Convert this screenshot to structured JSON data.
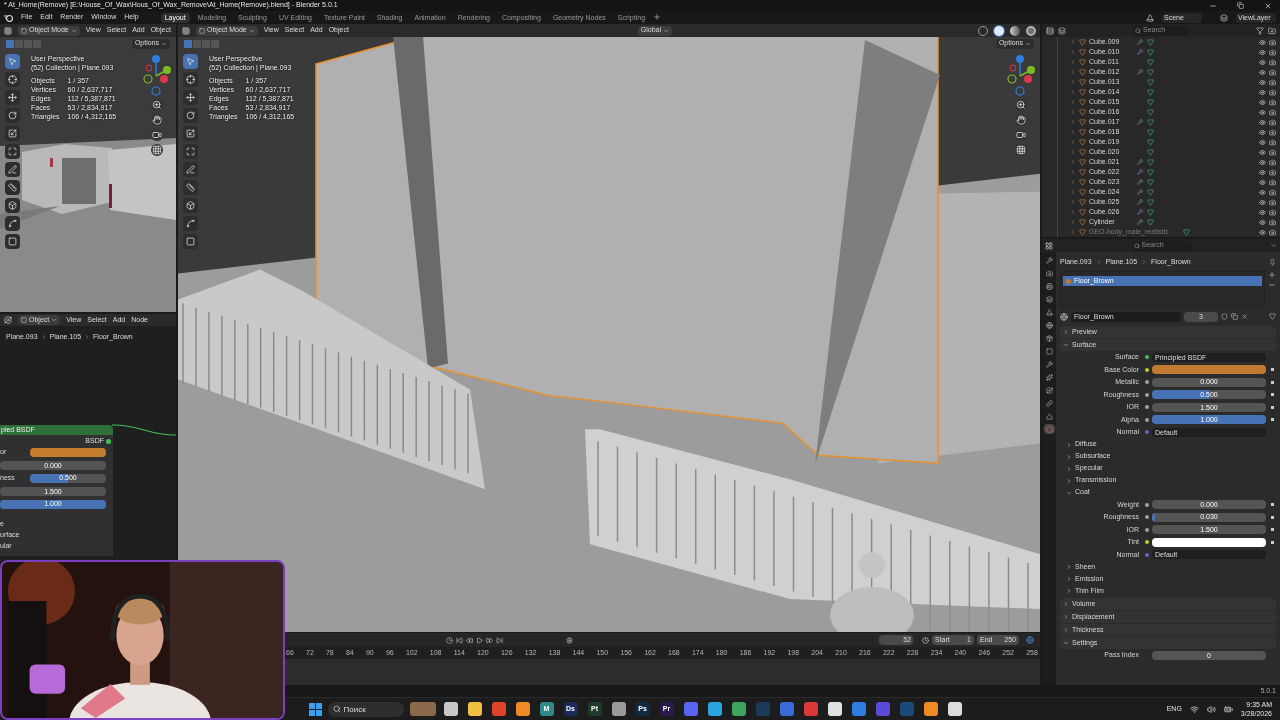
{
  "window": {
    "title": "* At_Home(Remove) [E:\\House_Of_Wax\\Hous_Of_Wax_Remove\\At_Home(Remove).blend] - Blender 5.0.1"
  },
  "menu": [
    "File",
    "Edit",
    "Render",
    "Window",
    "Help"
  ],
  "workspaces": [
    {
      "label": "Layout",
      "selected": true
    },
    {
      "label": "Modeling",
      "selected": false
    },
    {
      "label": "Sculpting",
      "selected": false
    },
    {
      "label": "UV Editing",
      "selected": false
    },
    {
      "label": "Texture Paint",
      "selected": false
    },
    {
      "label": "Shading",
      "selected": false
    },
    {
      "label": "Animation",
      "selected": false
    },
    {
      "label": "Rendering",
      "selected": false
    },
    {
      "label": "Compositing",
      "selected": false
    },
    {
      "label": "Geometry Nodes",
      "selected": false
    },
    {
      "label": "Scripting",
      "selected": false
    }
  ],
  "scene": "Scene",
  "view_layer": "ViewLayer",
  "viewports": [
    {
      "mode": "Object Mode",
      "menus": [
        "View",
        "Select",
        "Add",
        "Object"
      ],
      "options": "Options",
      "perspective": "User Perspective",
      "collection": "(52) Collection | Plane.093",
      "stats": [
        {
          "label": "Objects",
          "value": "1 / 357"
        },
        {
          "label": "Vertices",
          "value": "60 / 2,637,717"
        },
        {
          "label": "Edges",
          "value": "112 / 5,387,871"
        },
        {
          "label": "Faces",
          "value": "53 / 2,834,917"
        },
        {
          "label": "Triangles",
          "value": "106 / 4,312,165"
        }
      ],
      "tools": [
        {
          "kind": "select",
          "selected": true
        },
        {
          "kind": "cursor",
          "selected": false
        },
        {
          "kind": "move",
          "selected": false
        },
        {
          "kind": "rotate",
          "selected": false
        },
        {
          "kind": "scale",
          "selected": false
        },
        {
          "kind": "transform",
          "selected": false
        },
        {
          "kind": "annotate",
          "selected": false
        },
        {
          "kind": "measure",
          "selected": false
        },
        {
          "kind": "add",
          "selected": false
        },
        {
          "kind": "curve",
          "selected": false
        },
        {
          "kind": "square",
          "selected": false
        }
      ]
    },
    {
      "mode": "Object Mode",
      "menus": [
        "View",
        "Select",
        "Add",
        "Object"
      ],
      "options": "Options",
      "orientation": "Global",
      "perspective": "User Perspective",
      "collection": "(52) Collection | Plane.093",
      "stats": [
        {
          "label": "Objects",
          "value": "1 / 357"
        },
        {
          "label": "Vertices",
          "value": "60 / 2,637,717"
        },
        {
          "label": "Edges",
          "value": "112 / 5,387,871"
        },
        {
          "label": "Faces",
          "value": "53 / 2,834,917"
        },
        {
          "label": "Triangles",
          "value": "106 / 4,312,165"
        }
      ],
      "tools": [
        {
          "kind": "select",
          "selected": true
        },
        {
          "kind": "cursor",
          "selected": false
        },
        {
          "kind": "move",
          "selected": false
        },
        {
          "kind": "rotate",
          "selected": false
        },
        {
          "kind": "scale",
          "selected": false
        },
        {
          "kind": "transform",
          "selected": false
        },
        {
          "kind": "annotate",
          "selected": false
        },
        {
          "kind": "measure",
          "selected": false
        },
        {
          "kind": "add",
          "selected": false
        },
        {
          "kind": "curve",
          "selected": false
        },
        {
          "kind": "square",
          "selected": false
        }
      ],
      "shading_modes": [
        {
          "kind": "wireframe",
          "selected": false
        },
        {
          "kind": "solid",
          "selected": true
        },
        {
          "kind": "material",
          "selected": false
        },
        {
          "kind": "rendered",
          "selected": false
        }
      ]
    }
  ],
  "node_editor": {
    "mode": "Object",
    "menus": [
      "View",
      "Select",
      "Add",
      "Node"
    ],
    "breadcrumb": [
      "Plane.093",
      "Plane.105",
      "Floor_Brown"
    ],
    "node": {
      "title": "pled BSDF",
      "output": "BSDF",
      "rows": [
        {
          "kind": "color",
          "label": "or",
          "color": "#c47d2e"
        },
        {
          "kind": "number",
          "value": "0.000"
        },
        {
          "kind": "slider",
          "label": "ness",
          "value": "0.500",
          "level": 0.5
        },
        {
          "kind": "number",
          "value": "1.500"
        },
        {
          "kind": "slider",
          "value": "1.000",
          "level": 1
        }
      ],
      "sections": [
        "e",
        "urface",
        "ular"
      ]
    }
  },
  "timeline": {
    "frame": "52",
    "start_label": "Start",
    "start": "1",
    "end_label": "End",
    "end": "250",
    "ticks": [
      "66",
      "72",
      "78",
      "84",
      "90",
      "96",
      "102",
      "108",
      "114",
      "120",
      "126",
      "132",
      "138",
      "144",
      "150",
      "156",
      "162",
      "168",
      "174",
      "180",
      "186",
      "192",
      "198",
      "204",
      "210",
      "216",
      "222",
      "228",
      "234",
      "240",
      "246",
      "252",
      "258"
    ]
  },
  "outliner": {
    "search_placeholder": "Search",
    "items": [
      {
        "name": "Cube.009",
        "modifier": true,
        "disabled": false
      },
      {
        "name": "Cube.010",
        "modifier": true,
        "disabled": false
      },
      {
        "name": "Cube.011",
        "modifier": false,
        "disabled": false
      },
      {
        "name": "Cube.012",
        "modifier": true,
        "disabled": false
      },
      {
        "name": "Cube.013",
        "modifier": false,
        "disabled": false
      },
      {
        "name": "Cube.014",
        "modifier": false,
        "disabled": false
      },
      {
        "name": "Cube.015",
        "modifier": false,
        "disabled": false
      },
      {
        "name": "Cube.016",
        "modifier": false,
        "disabled": false
      },
      {
        "name": "Cube.017",
        "modifier": true,
        "disabled": false
      },
      {
        "name": "Cube.018",
        "modifier": false,
        "disabled": false
      },
      {
        "name": "Cube.019",
        "modifier": false,
        "disabled": false
      },
      {
        "name": "Cube.020",
        "modifier": false,
        "disabled": false
      },
      {
        "name": "Cube.021",
        "modifier": true,
        "disabled": false
      },
      {
        "name": "Cube.022",
        "modifier": true,
        "disabled": false
      },
      {
        "name": "Cube.023",
        "modifier": true,
        "disabled": false
      },
      {
        "name": "Cube.024",
        "modifier": true,
        "disabled": false
      },
      {
        "name": "Cube.025",
        "modifier": true,
        "disabled": false
      },
      {
        "name": "Cube.026",
        "modifier": true,
        "disabled": false
      },
      {
        "name": "Cylinder",
        "modifier": true,
        "disabled": false
      },
      {
        "name": "GEO-body_male_realistic",
        "modifier": false,
        "disabled": true
      }
    ]
  },
  "properties": {
    "search_placeholder": "Search",
    "tabs": [
      {
        "kind": "tool",
        "selected": false
      },
      {
        "kind": "render",
        "selected": false
      },
      {
        "kind": "output",
        "selected": false
      },
      {
        "kind": "view_layer",
        "selected": false
      },
      {
        "kind": "scene",
        "selected": false
      },
      {
        "kind": "world",
        "selected": false
      },
      {
        "kind": "collection",
        "selected": false
      },
      {
        "kind": "object",
        "selected": false
      },
      {
        "kind": "modifier",
        "selected": false
      },
      {
        "kind": "particles",
        "selected": false
      },
      {
        "kind": "physics",
        "selected": false
      },
      {
        "kind": "constraints",
        "selected": false
      },
      {
        "kind": "data",
        "selected": false
      },
      {
        "kind": "material",
        "selected": true
      }
    ],
    "breadcrumb": [
      "Plane.093",
      "Plane.105",
      "Floor_Brown"
    ],
    "slots": [
      {
        "name": "Floor_Brown",
        "selected": true
      }
    ],
    "material": {
      "name": "Floor_Brown",
      "users": "3"
    },
    "panels": [
      {
        "title": "Preview",
        "expanded": false
      },
      {
        "title": "Surface",
        "expanded": true,
        "rows": [
          {
            "kind": "shader",
            "label": "Surface",
            "value": "Principled BSDF"
          },
          {
            "kind": "color",
            "label": "Base Color",
            "color": "#c17a2f"
          },
          {
            "kind": "slider",
            "label": "Metallic",
            "value": "0.000",
            "level": 0
          },
          {
            "kind": "slider",
            "label": "Roughness",
            "value": "0.500",
            "level": 0.5
          },
          {
            "kind": "number",
            "label": "IOR",
            "value": "1.500"
          },
          {
            "kind": "slider",
            "label": "Alpha",
            "value": "1.000",
            "level": 1
          },
          {
            "kind": "vector",
            "label": "Normal",
            "value": "Default"
          }
        ],
        "subpanels": [
          {
            "title": "Diffuse",
            "expanded": false
          },
          {
            "title": "Subsurface",
            "expanded": false
          },
          {
            "title": "Specular",
            "expanded": false
          },
          {
            "title": "Transmission",
            "expanded": false
          },
          {
            "title": "Coat",
            "expanded": true,
            "rows": [
              {
                "kind": "slider",
                "label": "Weight",
                "value": "0.000",
                "level": 0
              },
              {
                "kind": "slider",
                "label": "Roughness",
                "value": "0.030",
                "level": 0.03
              },
              {
                "kind": "number",
                "label": "IOR",
                "value": "1.500"
              },
              {
                "kind": "color",
                "label": "Tint",
                "color": "#ffffff"
              },
              {
                "kind": "vector",
                "label": "Normal",
                "value": "Default"
              }
            ]
          },
          {
            "title": "Sheen",
            "expanded": false
          },
          {
            "title": "Emission",
            "expanded": false
          },
          {
            "title": "Thin Film",
            "expanded": false
          }
        ]
      },
      {
        "title": "Volume",
        "expanded": false
      },
      {
        "title": "Displacement",
        "expanded": false
      },
      {
        "title": "Thickness",
        "expanded": false
      },
      {
        "title": "Settings",
        "expanded": true,
        "rows": [
          {
            "kind": "plain",
            "label": "Pass Index",
            "value": "0"
          }
        ]
      }
    ]
  },
  "status_bar": {
    "version": "5.0.1"
  },
  "taskbar": {
    "search_placeholder": "Поиск",
    "apps": [
      {
        "color": "#8a6a4a"
      },
      {
        "color": "#c8c8c8"
      },
      {
        "color": "#f0c040"
      },
      {
        "color": "#e0452b"
      },
      {
        "color": "#f08a24"
      },
      {
        "label": "M",
        "color": "#2c8a8a"
      },
      {
        "label": "Ds",
        "color": "#1c2a5a"
      },
      {
        "label": "Pt",
        "color": "#1d3a2a"
      },
      {
        "color": "#9a9a9a"
      },
      {
        "label": "Ps",
        "color": "#0f2a44"
      },
      {
        "label": "Pr",
        "color": "#2a1a4a"
      },
      {
        "color": "#5865f2"
      },
      {
        "color": "#2aa3df"
      },
      {
        "color": "#3da55d"
      },
      {
        "color": "#1b3a5a"
      },
      {
        "color": "#3a6ad8"
      },
      {
        "color": "#d83a3a"
      },
      {
        "color": "#e0e0e0"
      },
      {
        "color": "#2f7de0"
      },
      {
        "color": "#5a4ad8"
      },
      {
        "color": "#1b4a7a"
      },
      {
        "color": "#f08a24"
      },
      {
        "color": "#dddddd"
      }
    ],
    "language": "ENG",
    "time": "9:35 AM",
    "date": "3/28/2026"
  }
}
